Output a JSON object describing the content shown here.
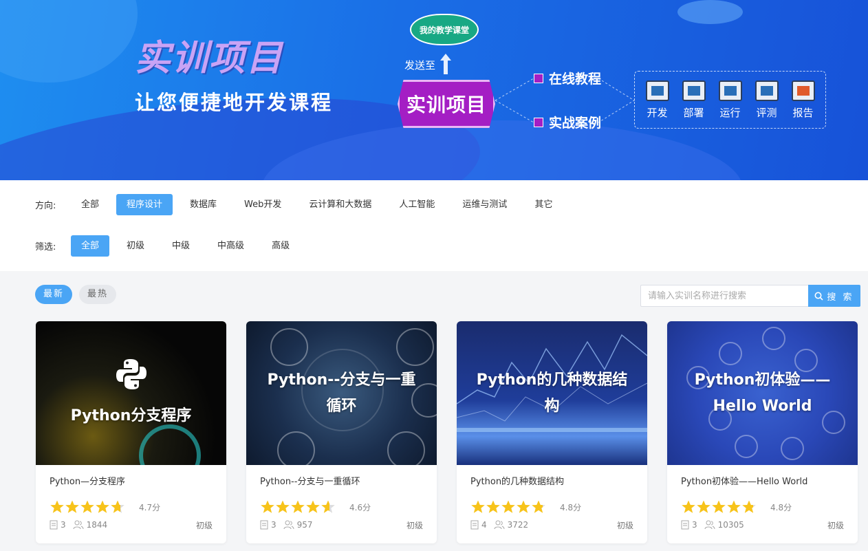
{
  "banner": {
    "title": "实训项目",
    "subtitle": "让您便捷地开发课程",
    "cloud_label": "我的教学课堂",
    "send_to": "发送至",
    "main_badge": "实训项目",
    "options": [
      "在线教程",
      "实战案例"
    ],
    "tools": [
      "开发",
      "部署",
      "运行",
      "评测",
      "报告"
    ]
  },
  "filters": {
    "direction_label": "方向:",
    "directions": [
      "全部",
      "程序设计",
      "数据库",
      "Web开发",
      "云计算和大数据",
      "人工智能",
      "运维与测试",
      "其它"
    ],
    "direction_active": "程序设计",
    "level_label": "筛选:",
    "levels": [
      "全部",
      "初级",
      "中级",
      "中高级",
      "高级"
    ],
    "level_active": "全部"
  },
  "sort": {
    "newest": "最新",
    "hottest": "最热"
  },
  "search": {
    "placeholder": "请输入实训名称进行搜索",
    "button": "搜 索"
  },
  "cards": [
    {
      "thumb_text": "Python分支程序",
      "title": "Python—分支程序",
      "rating": 4.7,
      "score": "4.7分",
      "chapters": "3",
      "learners": "1844",
      "level": "初级"
    },
    {
      "thumb_text": "Python--分支与一重循环",
      "title": "Python--分支与一重循环",
      "rating": 4.6,
      "score": "4.6分",
      "chapters": "3",
      "learners": "957",
      "level": "初级"
    },
    {
      "thumb_text": "Python的几种数据结构",
      "title": "Python的几种数据结构",
      "rating": 4.8,
      "score": "4.8分",
      "chapters": "4",
      "learners": "3722",
      "level": "初级"
    },
    {
      "thumb_text": "Python初体验——Hello World",
      "title": "Python初体验——Hello World",
      "rating": 4.8,
      "score": "4.8分",
      "chapters": "3",
      "learners": "10305",
      "level": "初级"
    }
  ],
  "colors": {
    "accent": "#4aa5f5",
    "star": "#f7c31a",
    "badge": "#a41ec4"
  }
}
